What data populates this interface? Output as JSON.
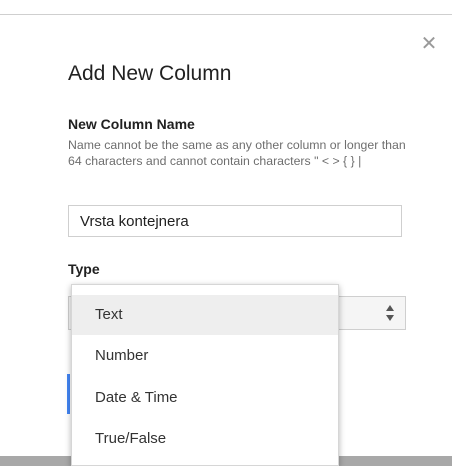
{
  "dialog": {
    "title": "Add New Column",
    "close_icon": "close-icon",
    "name_label": "New Column Name",
    "name_help": "Name cannot be the same as any other column or longer than 64 characters and cannot contain characters \" < > { } |",
    "name_value": "Vrsta kontejnera",
    "type_label": "Type"
  },
  "type_dropdown": {
    "selected": "Text",
    "options": [
      "Text",
      "Number",
      "Date & Time",
      "True/False"
    ]
  },
  "colors": {
    "accent": "#4285f4",
    "text": "#212121",
    "help_text": "#6e6e6e"
  }
}
